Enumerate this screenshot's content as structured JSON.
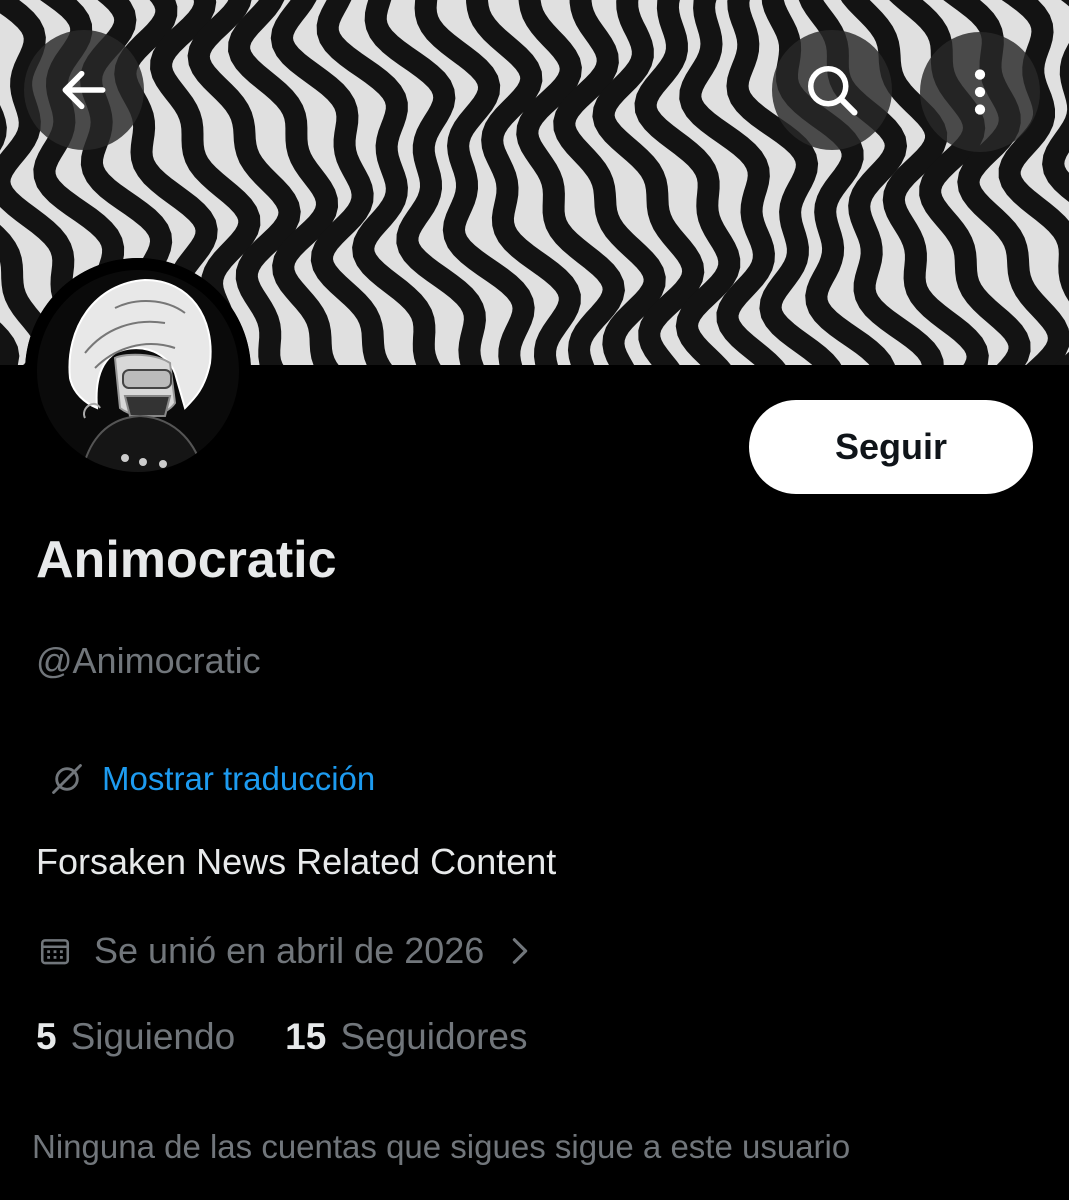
{
  "header": {
    "back_icon": "arrow-left-icon",
    "search_icon": "search-icon",
    "more_icon": "more-vertical-icon"
  },
  "profile": {
    "display_name": "Animocratic",
    "handle": "@Animocratic",
    "follow_label": "Seguir",
    "translate_label": "Mostrar traducción",
    "bio": "Forsaken News Related Content",
    "joined": "Se unió en abril de 2026",
    "following_count": "5",
    "following_label": "Siguiendo",
    "followers_count": "15",
    "followers_label": "Seguidores",
    "mutual_note": "Ninguna de las cuentas que sigues sigue a este usuario"
  },
  "colors": {
    "background": "#000000",
    "text_primary": "#e7e9ea",
    "text_secondary": "#71767b",
    "link": "#1d9bf0",
    "button_bg": "#ffffff"
  }
}
